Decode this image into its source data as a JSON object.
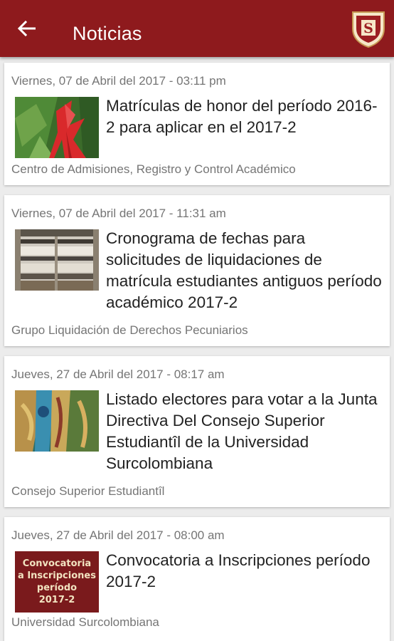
{
  "header": {
    "title": "Noticias",
    "back_icon": "arrow-back-icon",
    "logo_icon": "university-shield-logo",
    "logo_letter": "S",
    "bar_color": "#8e1a1d"
  },
  "news": [
    {
      "date": "Viernes, 07 de Abril del 2017 - 03:11 pm",
      "title": "Matrículas de honor del período 2016-2 para aplicar en el 2017-2",
      "source": "Centro de Admisiones, Registro y Control Académico",
      "image": "tropical-plant-photo"
    },
    {
      "date": "Viernes, 07 de Abril del 2017 - 11:31 am",
      "title": "Cronograma de fechas para solicitudes de liquidaciones de matrícula estudiantes antiguos período académico 2017-2",
      "source": "Grupo Liquidación de Derechos Pecuniarios",
      "image": "building-atrium-photo"
    },
    {
      "date": "Jueves, 27 de Abril del 2017 - 08:17 am",
      "title": "Listado electores para votar a la Junta Directiva Del Consejo Superior Estudiantîl de la Universidad Surcolombiana",
      "source": "Consejo Superior Estudiantîl",
      "image": "mural-painting-photo"
    },
    {
      "date": "Jueves, 27 de Abril del 2017 - 08:00 am",
      "title": "Convocatoria a Inscripciones período 2017-2",
      "source": "Universidad Surcolombiana",
      "image": "convocatoria-banner",
      "image_lines": [
        "Convocatoria",
        "a Inscripciones",
        "período",
        "2017-2"
      ]
    }
  ]
}
